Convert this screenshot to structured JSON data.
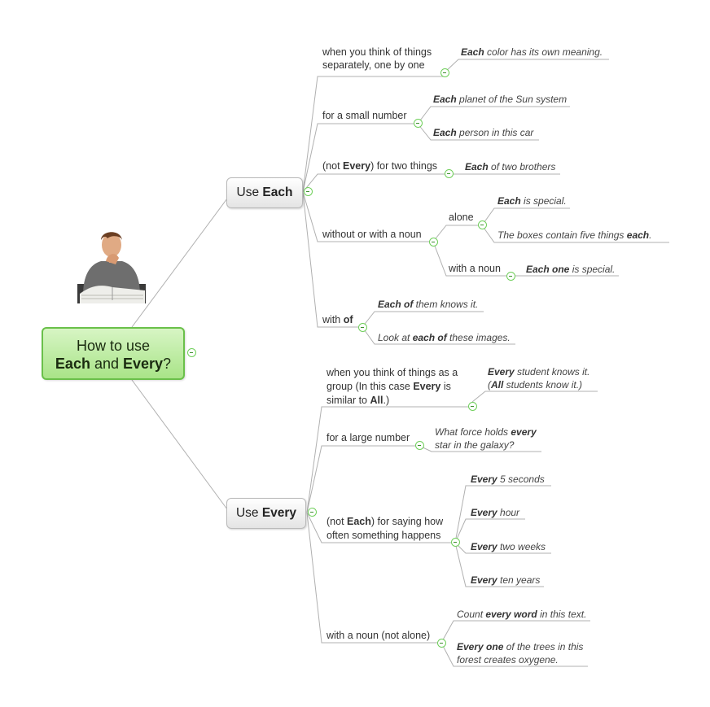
{
  "root": {
    "line1": "How to use",
    "b1": "Each",
    "mid": " and ",
    "b2": "Every",
    "end": "?"
  },
  "each_branch": {
    "prefix": "Use ",
    "bold": "Each",
    "topics": [
      {
        "label_lines": [
          "when you think of things",
          "separately, one by one"
        ],
        "examples": [
          {
            "bold": "Each",
            "rest": " color has its own meaning."
          }
        ]
      },
      {
        "label": "for a small number",
        "examples": [
          {
            "bold": "Each",
            "rest": " planet of the Sun system"
          },
          {
            "bold": "Each",
            "rest": " person in this car"
          }
        ]
      },
      {
        "pre": "(not ",
        "bold": "Every",
        "post": ") for two things",
        "examples": [
          {
            "bold": "Each",
            "rest": " of two brothers"
          }
        ]
      },
      {
        "label": "without or with a noun",
        "subtopics": [
          {
            "label": "alone",
            "examples": [
              {
                "bold": "Each",
                "rest": " is special."
              },
              {
                "pre": "The boxes contain five things ",
                "bold": "each",
                "post": "."
              }
            ]
          },
          {
            "label": "with a noun",
            "examples": [
              {
                "bold": "Each one",
                "rest": " is special."
              }
            ]
          }
        ]
      },
      {
        "pre": "with ",
        "bold": "of",
        "examples": [
          {
            "bold": "Each of",
            "rest": " them knows it."
          },
          {
            "pre": "Look at ",
            "bold": "each of",
            "post": " these images."
          }
        ]
      }
    ]
  },
  "every_branch": {
    "prefix": "Use ",
    "bold": "Every",
    "topics": [
      {
        "line1": "when you think of things as a",
        "line2_pre": "group (In this case ",
        "line2_bold": "Every",
        "line2_post": " is",
        "line3_pre": "similar to ",
        "line3_bold": "All",
        "line3_post": ".)",
        "examples": [
          {
            "bold": "Every",
            "rest": " student knows it.",
            "line2_pre": "(",
            "line2_bold": "All",
            "line2_post": " students know it.)"
          }
        ]
      },
      {
        "label": "for a large number",
        "examples": [
          {
            "pre": "What force holds ",
            "bold": "every",
            "line2": "star in the galaxy?"
          }
        ]
      },
      {
        "pre": "(not ",
        "bold": "Each",
        "post": ") for saying how",
        "line2": "often something happens",
        "examples": [
          {
            "bold": "Every",
            "rest": " 5 seconds"
          },
          {
            "bold": "Every",
            "rest": " hour"
          },
          {
            "bold": "Every",
            "rest": " two weeks"
          },
          {
            "bold": "Every",
            "rest": " ten years"
          }
        ]
      },
      {
        "label": "with a noun (not alone)",
        "examples": [
          {
            "pre": "Count ",
            "bold": "every word",
            "post": " in this text."
          },
          {
            "bold": "Every one",
            "rest": " of the trees in this",
            "line2": "forest creates oxygene."
          }
        ]
      }
    ]
  },
  "colors": {
    "root_border": "#6ac04a",
    "toggle": "#6fcf5a",
    "line": "#a9a9a9"
  }
}
